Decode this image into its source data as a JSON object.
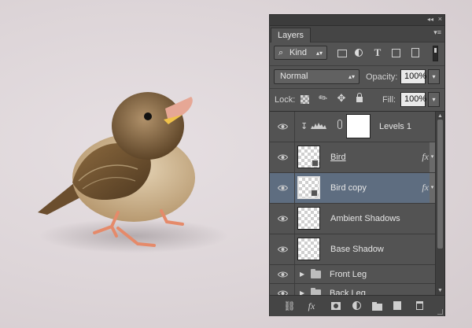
{
  "panel": {
    "collapse_icon": "double-chevron-right-icon",
    "collapse_glyph": "◂◂",
    "close_glyph": "×",
    "tab_label": "Layers",
    "menu_glyph": "▾≡"
  },
  "filter": {
    "kind_label": "Kind",
    "search_glyph": "⌕",
    "dropdown_glyph": "▴▾",
    "type_glyph": "T"
  },
  "blend": {
    "mode": "Normal",
    "opacity_label": "Opacity:",
    "opacity_value": "100%",
    "dropdown_glyph": "▴▾",
    "drop_arrow": "▾"
  },
  "lock": {
    "label": "Lock:",
    "move_glyph": "✥",
    "paint_glyph": "✎",
    "fill_label": "Fill:",
    "fill_value": "100%",
    "drop_arrow": "▾"
  },
  "layers": [
    {
      "name": "Levels 1",
      "type": "adjustment",
      "visible": true
    },
    {
      "name": "Bird",
      "type": "smart-object",
      "visible": true,
      "fx": true,
      "underline": true
    },
    {
      "name": "Bird copy",
      "type": "smart-object",
      "visible": true,
      "fx": true,
      "selected": true
    },
    {
      "name": "Ambient Shadows",
      "type": "pixel",
      "visible": true
    },
    {
      "name": "Base Shadow",
      "type": "pixel",
      "visible": true
    },
    {
      "name": "Front Leg",
      "type": "group",
      "visible": true
    },
    {
      "name": "Back Leg",
      "type": "group",
      "visible": true
    }
  ],
  "glyphs": {
    "clip": "↧",
    "fx": "fx",
    "fx_arrow": "▾",
    "twisty": "▶",
    "scroll_up": "▲",
    "scroll_down": "▼",
    "link": "⛓"
  },
  "colors": {
    "panel_bg": "#535353",
    "selected_row": "#5e6d80",
    "canvas_bg": "#ddd5d8"
  }
}
